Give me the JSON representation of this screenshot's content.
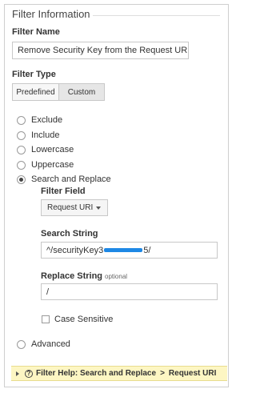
{
  "section_title": "Filter Information",
  "filter_name": {
    "label": "Filter Name",
    "value": "Remove Security Key from the Request URI"
  },
  "filter_type": {
    "label": "Filter Type",
    "tabs": [
      {
        "label": "Predefined",
        "selected": false
      },
      {
        "label": "Custom",
        "selected": true
      }
    ],
    "options": [
      {
        "label": "Exclude",
        "checked": false
      },
      {
        "label": "Include",
        "checked": false
      },
      {
        "label": "Lowercase",
        "checked": false
      },
      {
        "label": "Uppercase",
        "checked": false
      },
      {
        "label": "Search and Replace",
        "checked": true
      }
    ],
    "advanced_label": "Advanced"
  },
  "search_replace": {
    "filter_field_label": "Filter Field",
    "filter_field_value": "Request URI",
    "search_string_label": "Search String",
    "search_string_prefix": "^/securityKey3",
    "search_string_suffix": "5/",
    "replace_string_label": "Replace String",
    "replace_optional": "optional",
    "replace_string_value": "/",
    "case_sensitive_label": "Case Sensitive"
  },
  "help_bar": {
    "prefix": "Filter Help: Search and Replace",
    "separator": ">",
    "suffix": "Request URI"
  },
  "colors": {
    "help_bg": "#fdf6c3",
    "redaction": "#1e88e5"
  }
}
